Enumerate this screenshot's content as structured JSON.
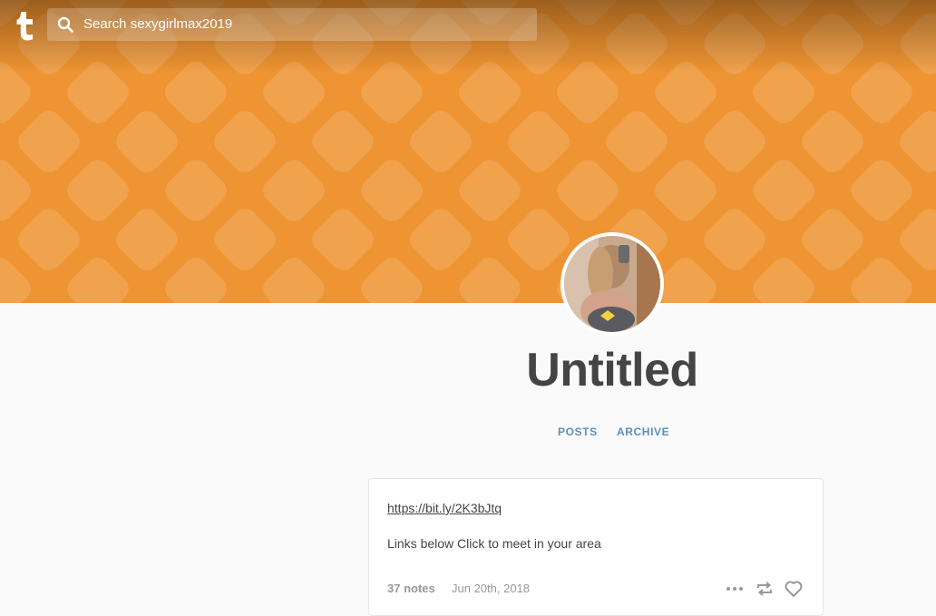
{
  "header": {
    "background_color": "#ee9432",
    "logo_icon": "tumblr-logo-icon",
    "search": {
      "icon": "search-icon",
      "placeholder": "Search sexygirlmax2019"
    }
  },
  "blog": {
    "avatar_icon": "avatar",
    "title": "Untitled",
    "nav": {
      "posts_label": "POSTS",
      "archive_label": "ARCHIVE"
    }
  },
  "post": {
    "link": "https://bit.ly/2K3bJtq",
    "body": "Links below Click to meet in your area",
    "notes": "37 notes",
    "date": "Jun 20th, 2018",
    "actions": [
      "more-icon",
      "reblog-icon",
      "heart-icon"
    ]
  },
  "colors": {
    "accent": "#ee9432",
    "link": "#5b8ebd",
    "text": "#444444",
    "muted": "#999999"
  }
}
